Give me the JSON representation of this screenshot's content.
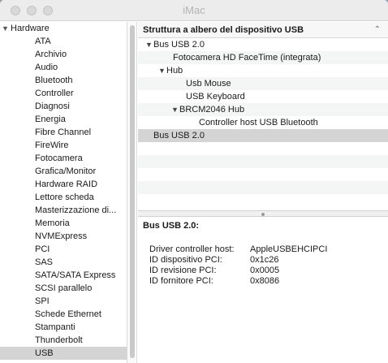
{
  "window": {
    "title": "iMac"
  },
  "sidebar": {
    "category": "Hardware",
    "items": [
      "ATA",
      "Archivio",
      "Audio",
      "Bluetooth",
      "Controller",
      "Diagnosi",
      "Energia",
      "Fibre Channel",
      "FireWire",
      "Fotocamera",
      "Grafica/Monitor",
      "Hardware RAID",
      "Lettore scheda",
      "Masterizzazione di...",
      "Memoria",
      "NVMExpress",
      "PCI",
      "SAS",
      "SATA/SATA Express",
      "SCSI parallelo",
      "SPI",
      "Schede Ethernet",
      "Stampanti",
      "Thunderbolt",
      "USB"
    ],
    "selected_index": 24
  },
  "tree": {
    "header": "Struttura a albero del dispositivo USB",
    "rows": [
      {
        "label": "Bus USB 2.0",
        "level": 0,
        "expanded": true
      },
      {
        "label": "Fotocamera HD FaceTime (integrata)",
        "level": 1,
        "expanded": null
      },
      {
        "label": "Hub",
        "level": 1,
        "expanded": true
      },
      {
        "label": "Usb Mouse",
        "level": 2,
        "expanded": null
      },
      {
        "label": "USB Keyboard",
        "level": 2,
        "expanded": null
      },
      {
        "label": "BRCM2046 Hub",
        "level": 2,
        "expanded": true
      },
      {
        "label": "Controller host USB Bluetooth",
        "level": 3,
        "expanded": null
      },
      {
        "label": "Bus USB 2.0",
        "level": 0,
        "expanded": null,
        "selected": true
      }
    ]
  },
  "details": {
    "heading": "Bus USB 2.0:",
    "fields": [
      {
        "key": "Driver controller host:",
        "value": "AppleUSBEHCIPCI"
      },
      {
        "key": "ID dispositivo PCI:",
        "value": "0x1c26"
      },
      {
        "key": "ID revisione PCI:",
        "value": "0x0005"
      },
      {
        "key": "ID fornitore PCI:",
        "value": "0x8086"
      }
    ]
  },
  "icons": {
    "disclosure_open": "▼",
    "collapse_chevron": "⌃"
  }
}
